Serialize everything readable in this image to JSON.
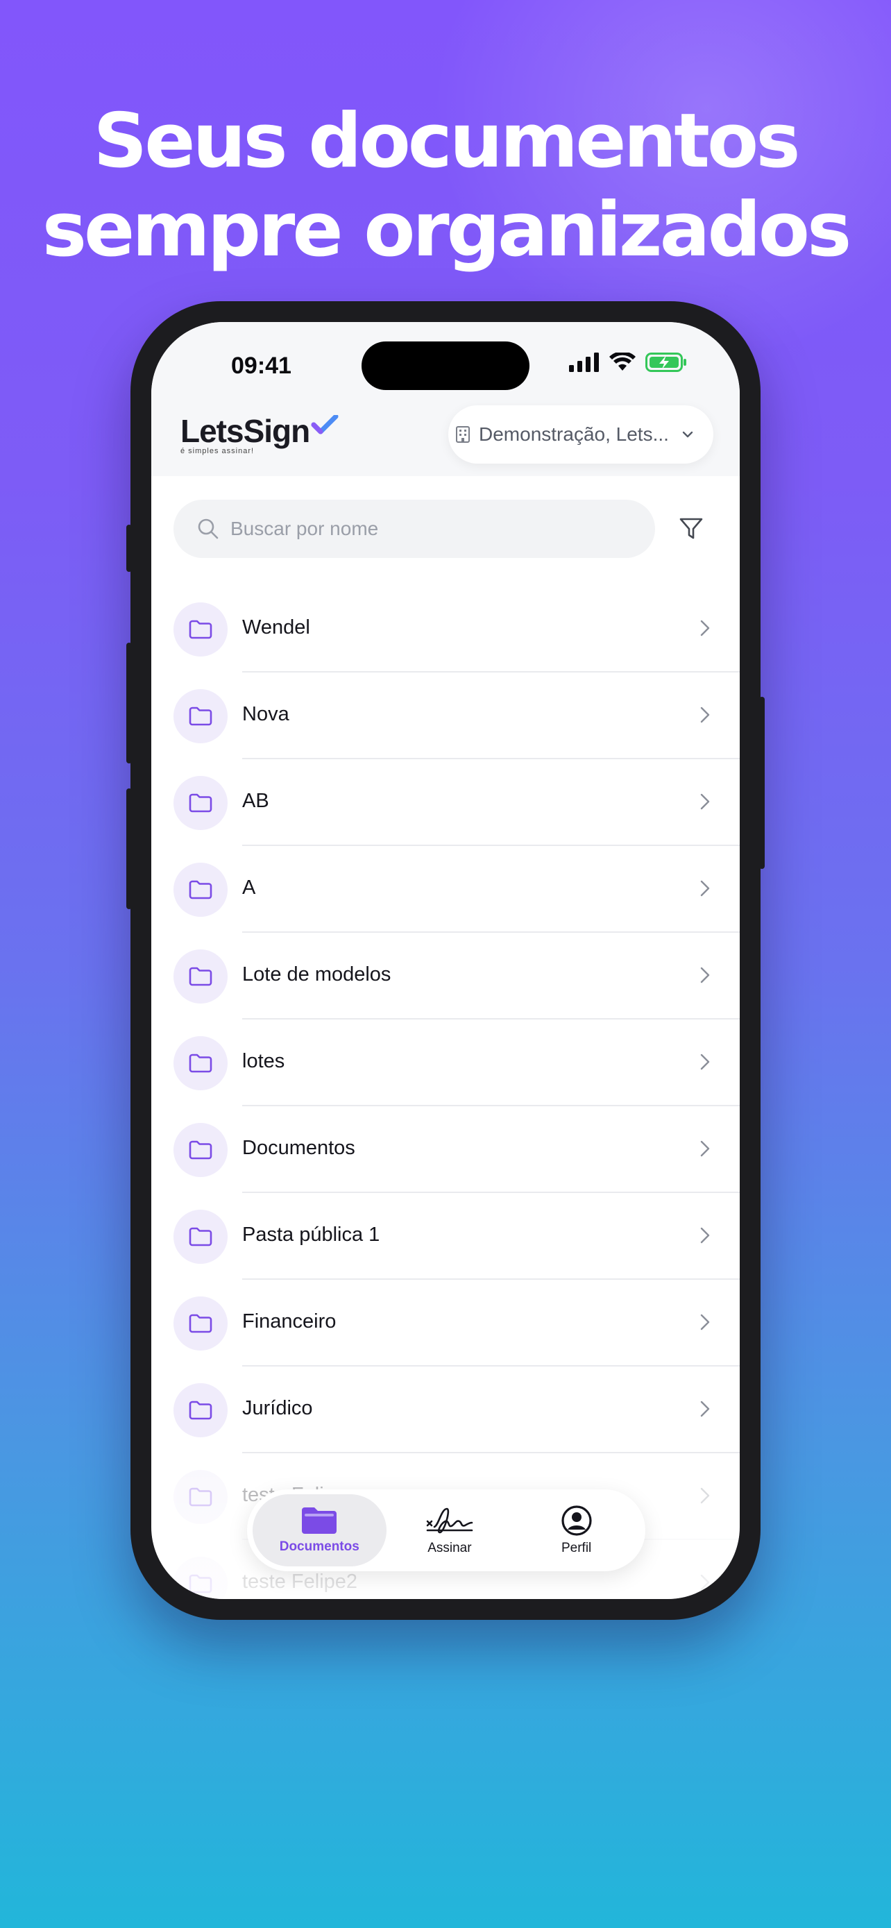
{
  "headline": {
    "line1": "Seus documentos",
    "line2": "sempre organizados"
  },
  "status_bar": {
    "time": "09:41",
    "icons": [
      "cellular-signal-icon",
      "wifi-icon",
      "battery-charging-icon"
    ]
  },
  "header": {
    "logo_text": "LetsSign",
    "logo_tagline": "é simples assinar!",
    "org_selector": "Demonstração, Lets..."
  },
  "search": {
    "placeholder": "Buscar por nome"
  },
  "folders": [
    {
      "label": "Wendel"
    },
    {
      "label": "Nova"
    },
    {
      "label": "AB"
    },
    {
      "label": "A"
    },
    {
      "label": "Lote de modelos"
    },
    {
      "label": "lotes"
    },
    {
      "label": "Documentos"
    },
    {
      "label": "Pasta pública 1"
    },
    {
      "label": "Financeiro"
    },
    {
      "label": "Jurídico"
    },
    {
      "label": "teste Felipe"
    },
    {
      "label": "teste Felipe2"
    }
  ],
  "tabbar": {
    "tabs": [
      {
        "label": "Documentos",
        "icon": "folder-icon",
        "active": true
      },
      {
        "label": "Assinar",
        "icon": "signature-icon",
        "active": false
      },
      {
        "label": "Perfil",
        "icon": "profile-icon",
        "active": false
      }
    ]
  },
  "colors": {
    "accent": "#7b4be6",
    "bg_top": "#8256fb",
    "bg_bottom": "#22b6da"
  }
}
